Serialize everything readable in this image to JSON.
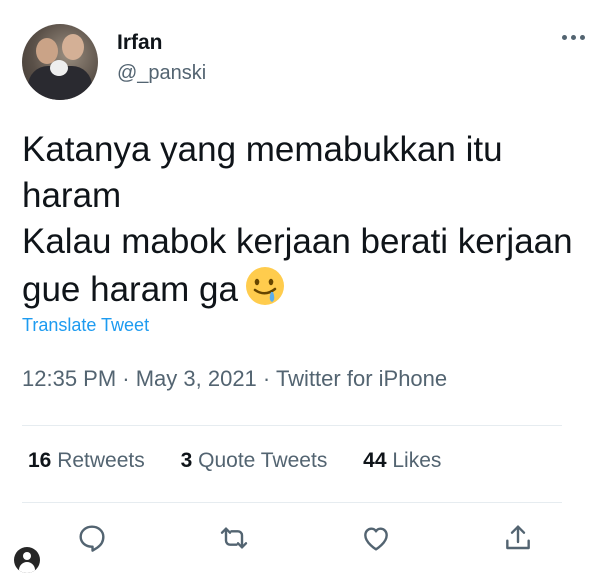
{
  "author": {
    "name": "Irfan",
    "handle": "@_panski"
  },
  "tweet": {
    "lines": [
      "Katanya yang memabukkan itu",
      "haram",
      "Kalau mabok kerjaan berati kerjaan",
      "gue haram ga"
    ],
    "emoji": "drooling-face-icon",
    "translate_label": "Translate Tweet",
    "meta": "12:35 PM · May 3, 2021 · Twitter for iPhone"
  },
  "stats": {
    "retweets_count": "16",
    "retweets_label": "Retweets",
    "quotes_count": "3",
    "quotes_label": "Quote Tweets",
    "likes_count": "44",
    "likes_label": "Likes"
  },
  "actions": [
    "reply-icon",
    "retweet-icon",
    "like-icon",
    "share-icon"
  ],
  "colors": {
    "text": "#0f1419",
    "secondary": "#536471",
    "link": "#1d9bf0",
    "divider": "#e6ecf0",
    "emoji": "#ffcc4d"
  }
}
